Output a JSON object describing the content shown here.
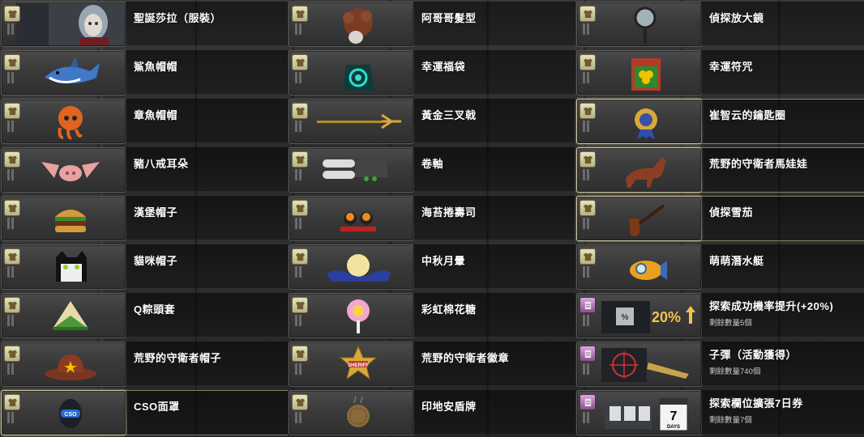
{
  "items": [
    {
      "label": "聖誕莎拉（服裝）",
      "icon": "santa-sarah-portrait-icon",
      "badge": "shirt"
    },
    {
      "label": "阿哥哥髮型",
      "icon": "afro-wig-icon",
      "badge": "shirt"
    },
    {
      "label": "偵探放大鏡",
      "icon": "magnifying-glass-icon",
      "badge": "shirt"
    },
    {
      "label": "鯊魚帽帽",
      "icon": "shark-hat-icon",
      "badge": "shirt"
    },
    {
      "label": "幸運福袋",
      "icon": "lucky-bag-icon",
      "badge": "shirt"
    },
    {
      "label": "幸運符咒",
      "icon": "clover-charm-icon",
      "badge": "shirt"
    },
    {
      "label": "章魚帽帽",
      "icon": "octopus-hat-icon",
      "badge": "shirt"
    },
    {
      "label": "黃金三叉戟",
      "icon": "golden-trident-icon",
      "badge": "shirt"
    },
    {
      "label": "崔智云的鑰匙圈",
      "icon": "medal-keyring-icon",
      "badge": "shirt",
      "highlight": true
    },
    {
      "label": "豬八戒耳朵",
      "icon": "pig-ears-icon",
      "badge": "shirt"
    },
    {
      "label": "卷軸",
      "icon": "scroll-icon",
      "badge": "shirt"
    },
    {
      "label": "荒野的守衛者馬娃娃",
      "icon": "horse-doll-icon",
      "badge": "shirt",
      "highlight": true
    },
    {
      "label": "漢堡帽子",
      "icon": "burger-hat-icon",
      "badge": "shirt"
    },
    {
      "label": "海苔捲壽司",
      "icon": "sushi-icon",
      "badge": "shirt"
    },
    {
      "label": "偵探雪茄",
      "icon": "pipe-icon",
      "badge": "shirt",
      "highlight": true
    },
    {
      "label": "貓咪帽子",
      "icon": "cat-hat-icon",
      "badge": "shirt"
    },
    {
      "label": "中秋月暈",
      "icon": "moon-cloud-icon",
      "badge": "shirt"
    },
    {
      "label": "萌萌潛水艇",
      "icon": "submarine-icon",
      "badge": "shirt"
    },
    {
      "label": "Q粽頭套",
      "icon": "zongzi-hat-icon",
      "badge": "shirt"
    },
    {
      "label": "彩虹棉花糖",
      "icon": "cotton-candy-icon",
      "badge": "shirt"
    },
    {
      "label": "探索成功機率提升(+20%)",
      "sub": "剩餘數量5個",
      "icon": "rate-boost-icon",
      "badge": "scroll",
      "boost_text": "20%"
    },
    {
      "label": "荒野的守衛者帽子",
      "icon": "cowboy-hat-icon",
      "badge": "shirt"
    },
    {
      "label": "荒野的守衛者徽章",
      "icon": "sheriff-badge-icon",
      "badge": "shirt",
      "sheriff_text": "SHERIFF"
    },
    {
      "label": "子彈（活動獲得）",
      "sub": "剩餘數量740個",
      "icon": "bullet-icon",
      "badge": "scroll"
    },
    {
      "label": "CSO面罩",
      "icon": "cso-mask-icon",
      "badge": "shirt",
      "highlight": true,
      "mask_text": "CSO"
    },
    {
      "label": "印地安盾牌",
      "icon": "shield-icon",
      "badge": "shirt"
    },
    {
      "label": "探索欄位擴張7日券",
      "sub": "剩餘數量7個",
      "icon": "slot-expand-icon",
      "badge": "scroll",
      "calendar_num": "7",
      "calendar_text": "DAYS"
    }
  ]
}
